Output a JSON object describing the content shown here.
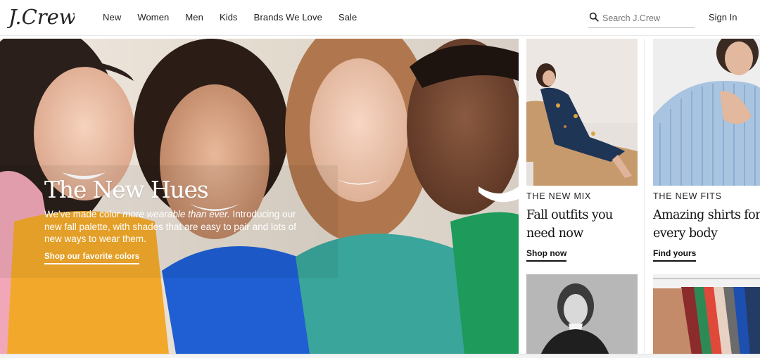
{
  "header": {
    "brand": "J.Crew",
    "nav": [
      "New",
      "Women",
      "Men",
      "Kids",
      "Brands We Love",
      "Sale"
    ],
    "search_placeholder": "Search J.Crew",
    "signin_label": "Sign In"
  },
  "hero": {
    "title": "The New Hues",
    "body_line1_pre": "We've made color ",
    "body_line1_em": "more wearable than ever.",
    "body_rest": "Introducing our new fall palette, with shades that are easy to pair and lots of new ways to wear them.",
    "cta": "Shop our favorite colors"
  },
  "promos": [
    {
      "eyebrow": "THE NEW MIX",
      "title": "Fall outfits you need now",
      "cta": "Shop now"
    },
    {
      "eyebrow": "THE NEW FITS",
      "title": "Amazing shirts for every body",
      "cta": "Find yours"
    }
  ],
  "colors": {
    "pink": "#f1a7b8",
    "mustard": "#f2a92b",
    "cobalt": "#1f5fd3",
    "teal": "#3aa59a",
    "green": "#1e9a5a"
  }
}
